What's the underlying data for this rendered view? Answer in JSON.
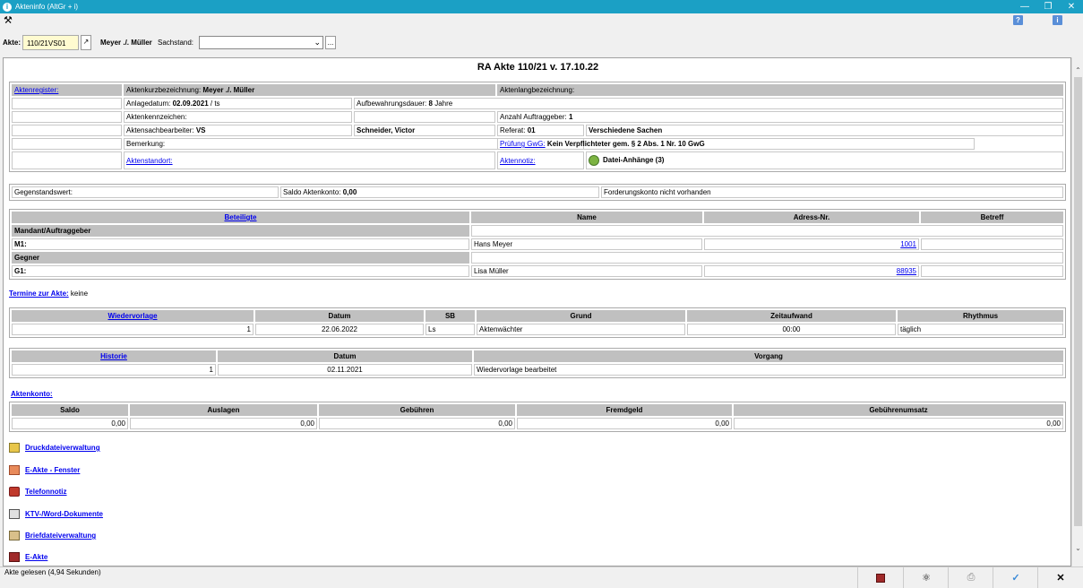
{
  "window": {
    "title": "Akteninfo (AltGr + i)"
  },
  "toolbar": {
    "akte_label": "Akte:",
    "akte_value": "110/21VS01",
    "parties": "Meyer ./. Müller",
    "sachstand_label": "Sachstand:",
    "sachstand_value": "",
    "more_label": "..."
  },
  "heading": "RA Akte 110/21 v. 17.10.22",
  "info": {
    "aktenregister": "Aktenregister:",
    "kurzbez_label": "Aktenkurzbezeichnung:",
    "kurzbez_value": "Meyer ./. Müller",
    "langbez_label": "Aktenlangbezeichnung:",
    "anlage_label": "Anlagedatum:",
    "anlage_value": "02.09.2021",
    "anlage_suffix": "/ ts",
    "aufbew_label": "Aufbewahrungsdauer:",
    "aufbew_value": "8",
    "aufbew_unit": "Jahre",
    "kennz_label": "Aktenkennzeichen:",
    "auftr_label": "Anzahl Auftraggeber:",
    "auftr_value": "1",
    "sachb_label": "Aktensachbearbeiter:",
    "sachb_value": "VS",
    "sachb_name": "Schneider, Victor",
    "referat_label": "Referat:",
    "referat_value": "01",
    "referat_name": "Verschiedene Sachen",
    "bemerkung_label": "Bemerkung:",
    "gwg_link": "Prüfung GwG:",
    "gwg_value": "Kein Verpflichteter gem. § 2 Abs. 1 Nr. 10 GwG",
    "standort_link": "Aktenstandort:",
    "notiz_link": "Aktennotiz:",
    "anhaenge": "Datei-Anhänge (3)"
  },
  "values_row": {
    "gegenstand_label": "Gegenstandswert:",
    "saldo_label": "Saldo Aktenkonto:",
    "saldo_value": "0,00",
    "forderung": "Forderungskonto nicht vorhanden"
  },
  "beteiligte": {
    "headers": [
      "Beteiligte",
      "Name",
      "Adress-Nr.",
      "Betreff"
    ],
    "group1": "Mandant/Auftraggeber",
    "role1": "M1:",
    "name1": "Hans Meyer",
    "addr1": "1001",
    "group2": "Gegner",
    "role2": "G1:",
    "name2": "Lisa Müller",
    "addr2": "88935"
  },
  "termine": {
    "label": "Termine zur Akte:",
    "value": "keine"
  },
  "wiedervorlage": {
    "headers": [
      "Wiedervorlage",
      "Datum",
      "SB",
      "Grund",
      "Zeitaufwand",
      "Rhythmus"
    ],
    "row": [
      "1",
      "22.06.2022",
      "Ls",
      "Aktenwächter",
      "00:00",
      "täglich"
    ]
  },
  "historie": {
    "headers": [
      "Historie",
      "Datum",
      "Vorgang"
    ],
    "row": [
      "1",
      "02.11.2021",
      "Wiedervorlage bearbeitet"
    ]
  },
  "aktenkonto": {
    "label": "Aktenkonto:",
    "headers": [
      "Saldo",
      "Auslagen",
      "Gebühren",
      "Fremdgeld",
      "Gebührenumsatz"
    ],
    "row": [
      "0,00",
      "0,00",
      "0,00",
      "0,00",
      "0,00"
    ]
  },
  "quicklinks": [
    "Druckdateiverwaltung",
    "E-Akte - Fenster",
    "Telefonnotiz",
    "KTV-/Word-Dokumente",
    "Briefdateiverwaltung",
    "E-Akte"
  ],
  "status": {
    "text": "Akte gelesen (4,94 Sekunden)"
  },
  "colors": {
    "titlebar": "#1ba0c5",
    "header_cell": "#c0c0c0",
    "akte_field": "#fffbd0",
    "link": "#0000ee"
  }
}
